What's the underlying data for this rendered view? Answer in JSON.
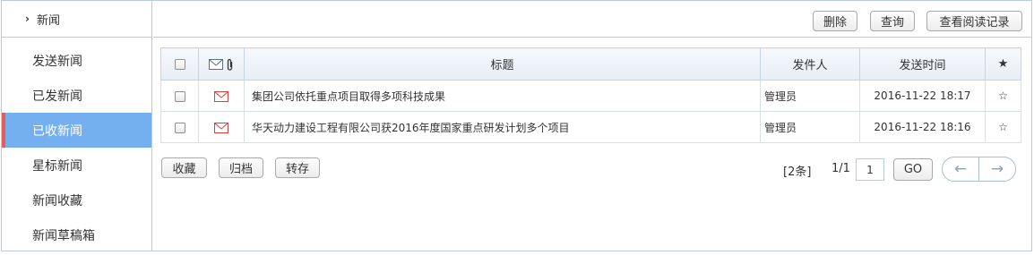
{
  "sidebar": {
    "header": "新闻",
    "items": [
      {
        "label": "发送新闻"
      },
      {
        "label": "已发新闻"
      },
      {
        "label": "已收新闻",
        "active": true
      },
      {
        "label": "星标新闻"
      },
      {
        "label": "新闻收藏"
      },
      {
        "label": "新闻草稿箱"
      }
    ]
  },
  "toolbar": {
    "delete_label": "删除",
    "query_label": "查询",
    "read_log_label": "查看阅读记录"
  },
  "table": {
    "columns": {
      "subject": "标题",
      "sender": "发件人",
      "time": "发送时间"
    },
    "rows": [
      {
        "subject": "集团公司依托重点项目取得多项科技成果",
        "sender": "管理员",
        "time": "2016-11-22 18:17"
      },
      {
        "subject": "华天动力建设工程有限公司获2016年度国家重点研发计划多个项目",
        "sender": "管理员",
        "time": "2016-11-22 18:16"
      }
    ]
  },
  "footer": {
    "collect_label": "收藏",
    "archive_label": "归档",
    "forward_label": "转存",
    "count_text": "[2条]",
    "page_text": "1/1",
    "page_value": "1",
    "go_label": "GO"
  },
  "colors": {
    "accent": "#74b0f0",
    "active_marker": "#e85b5b",
    "subject_text": "#e03d3d",
    "border": "#b9cbe0"
  },
  "icons": {
    "header_chevron": "chevron-right-icon",
    "mail_column": "mail-icon",
    "attach_column": "paperclip-icon",
    "row_mail": "unread-mail-icon",
    "star_header": "star-filled-icon",
    "star_row": "star-outline-icon",
    "prev": "arrow-left-icon",
    "next": "arrow-right-icon"
  }
}
